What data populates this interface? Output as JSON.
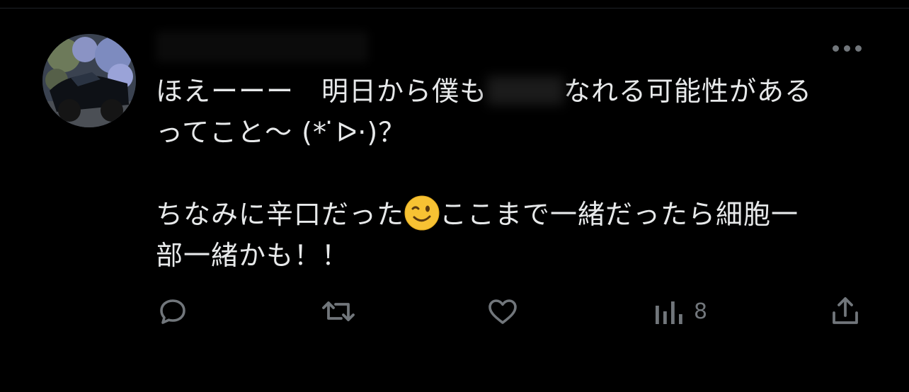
{
  "tweet": {
    "author_name": "",
    "lines": [
      {
        "before": "ほえーーー　明日から僕も",
        "after": "なれる可能性がある"
      },
      {
        "text": "ってこと～ (* ̇ᐅ·)？"
      },
      {
        "before": "ちなみに辛口だった",
        "after": "ここまで一緒だったら細胞一"
      },
      {
        "text": "部一緒かも！！"
      }
    ],
    "icons": {
      "more": "more-horizontal-icon",
      "reply": "reply-icon",
      "retweet": "retweet-icon",
      "like": "like-icon",
      "views": "views-icon",
      "share": "share-icon",
      "emoji": "winking-face-emoji"
    },
    "views_count": "8"
  },
  "colors": {
    "background": "#000000",
    "text": "#e7e9ea",
    "icon": "#71767b"
  }
}
